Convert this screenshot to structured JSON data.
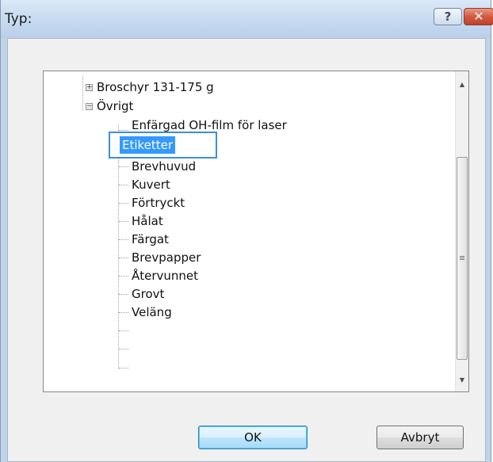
{
  "window": {
    "title": "Typ:"
  },
  "titlebar_buttons": {
    "help_glyph": "?",
    "close_glyph": "✕"
  },
  "tree": {
    "items": [
      {
        "label": "Broschyr 131-175 g",
        "expander": "+"
      },
      {
        "label": "Övrigt",
        "expander": "−"
      },
      {
        "label": "Enfärgad OH-film för laser"
      },
      {
        "label": "Etiketter",
        "selected": true
      },
      {
        "label": "Brevhuvud"
      },
      {
        "label": "Kuvert"
      },
      {
        "label": "Förtryckt"
      },
      {
        "label": "Hålat"
      },
      {
        "label": "Färgat"
      },
      {
        "label": "Brevpapper"
      },
      {
        "label": "Återvunnet"
      },
      {
        "label": "Grovt"
      },
      {
        "label": "Veläng"
      }
    ]
  },
  "scrollbar": {
    "up_arrow": "▲",
    "down_arrow": "▼"
  },
  "buttons": {
    "ok_label": "OK",
    "cancel_label": "Avbryt"
  },
  "colors": {
    "selection": "#3399ff",
    "focus_border": "#3d8fd6",
    "close_red": "#c0432a"
  }
}
